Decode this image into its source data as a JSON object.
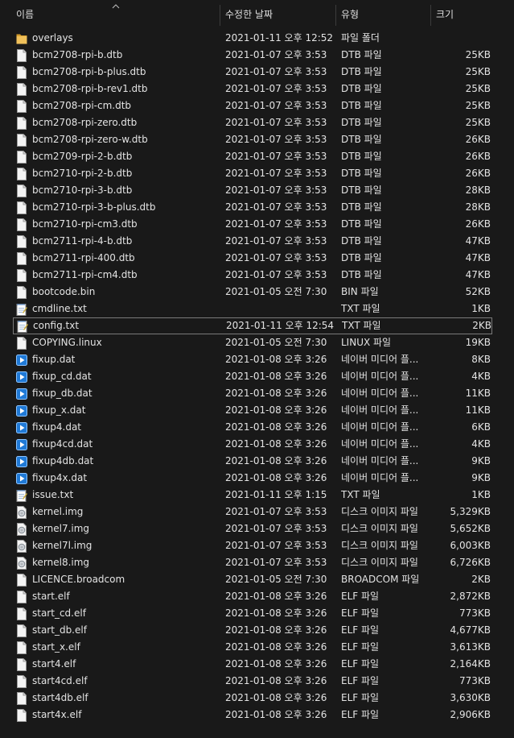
{
  "columns": {
    "name": "이름",
    "date": "수정한 날짜",
    "type": "유형",
    "size": "크기"
  },
  "colors": {
    "folder": "#e8b54a",
    "media": "#1f79d6",
    "selected_border": "#7a7a7a"
  },
  "files": [
    {
      "name": "overlays",
      "date": "2021-01-11 오후 12:52",
      "type": "파일 폴더",
      "size": "",
      "icon": "folder-icon"
    },
    {
      "name": "bcm2708-rpi-b.dtb",
      "date": "2021-01-07 오후 3:53",
      "type": "DTB 파일",
      "size": "25KB",
      "icon": "file-icon"
    },
    {
      "name": "bcm2708-rpi-b-plus.dtb",
      "date": "2021-01-07 오후 3:53",
      "type": "DTB 파일",
      "size": "25KB",
      "icon": "file-icon"
    },
    {
      "name": "bcm2708-rpi-b-rev1.dtb",
      "date": "2021-01-07 오후 3:53",
      "type": "DTB 파일",
      "size": "25KB",
      "icon": "file-icon"
    },
    {
      "name": "bcm2708-rpi-cm.dtb",
      "date": "2021-01-07 오후 3:53",
      "type": "DTB 파일",
      "size": "25KB",
      "icon": "file-icon"
    },
    {
      "name": "bcm2708-rpi-zero.dtb",
      "date": "2021-01-07 오후 3:53",
      "type": "DTB 파일",
      "size": "25KB",
      "icon": "file-icon"
    },
    {
      "name": "bcm2708-rpi-zero-w.dtb",
      "date": "2021-01-07 오후 3:53",
      "type": "DTB 파일",
      "size": "26KB",
      "icon": "file-icon"
    },
    {
      "name": "bcm2709-rpi-2-b.dtb",
      "date": "2021-01-07 오후 3:53",
      "type": "DTB 파일",
      "size": "26KB",
      "icon": "file-icon"
    },
    {
      "name": "bcm2710-rpi-2-b.dtb",
      "date": "2021-01-07 오후 3:53",
      "type": "DTB 파일",
      "size": "26KB",
      "icon": "file-icon"
    },
    {
      "name": "bcm2710-rpi-3-b.dtb",
      "date": "2021-01-07 오후 3:53",
      "type": "DTB 파일",
      "size": "28KB",
      "icon": "file-icon"
    },
    {
      "name": "bcm2710-rpi-3-b-plus.dtb",
      "date": "2021-01-07 오후 3:53",
      "type": "DTB 파일",
      "size": "28KB",
      "icon": "file-icon"
    },
    {
      "name": "bcm2710-rpi-cm3.dtb",
      "date": "2021-01-07 오후 3:53",
      "type": "DTB 파일",
      "size": "26KB",
      "icon": "file-icon"
    },
    {
      "name": "bcm2711-rpi-4-b.dtb",
      "date": "2021-01-07 오후 3:53",
      "type": "DTB 파일",
      "size": "47KB",
      "icon": "file-icon"
    },
    {
      "name": "bcm2711-rpi-400.dtb",
      "date": "2021-01-07 오후 3:53",
      "type": "DTB 파일",
      "size": "47KB",
      "icon": "file-icon"
    },
    {
      "name": "bcm2711-rpi-cm4.dtb",
      "date": "2021-01-07 오후 3:53",
      "type": "DTB 파일",
      "size": "47KB",
      "icon": "file-icon"
    },
    {
      "name": "bootcode.bin",
      "date": "2021-01-05 오전 7:30",
      "type": "BIN 파일",
      "size": "52KB",
      "icon": "file-icon"
    },
    {
      "name": "cmdline.txt",
      "date": "",
      "type": "TXT 파일",
      "size": "1KB",
      "icon": "notepad-icon"
    },
    {
      "name": "config.txt",
      "date": "2021-01-11 오후 12:54",
      "type": "TXT 파일",
      "size": "2KB",
      "icon": "notepad-icon",
      "selected": true
    },
    {
      "name": "COPYING.linux",
      "date": "2021-01-05 오전 7:30",
      "type": "LINUX 파일",
      "size": "19KB",
      "icon": "file-icon"
    },
    {
      "name": "fixup.dat",
      "date": "2021-01-08 오후 3:26",
      "type": "네이버 미디어 플...",
      "size": "8KB",
      "icon": "media-play-icon"
    },
    {
      "name": "fixup_cd.dat",
      "date": "2021-01-08 오후 3:26",
      "type": "네이버 미디어 플...",
      "size": "4KB",
      "icon": "media-play-icon"
    },
    {
      "name": "fixup_db.dat",
      "date": "2021-01-08 오후 3:26",
      "type": "네이버 미디어 플...",
      "size": "11KB",
      "icon": "media-play-icon"
    },
    {
      "name": "fixup_x.dat",
      "date": "2021-01-08 오후 3:26",
      "type": "네이버 미디어 플...",
      "size": "11KB",
      "icon": "media-play-icon"
    },
    {
      "name": "fixup4.dat",
      "date": "2021-01-08 오후 3:26",
      "type": "네이버 미디어 플...",
      "size": "6KB",
      "icon": "media-play-icon"
    },
    {
      "name": "fixup4cd.dat",
      "date": "2021-01-08 오후 3:26",
      "type": "네이버 미디어 플...",
      "size": "4KB",
      "icon": "media-play-icon"
    },
    {
      "name": "fixup4db.dat",
      "date": "2021-01-08 오후 3:26",
      "type": "네이버 미디어 플...",
      "size": "9KB",
      "icon": "media-play-icon"
    },
    {
      "name": "fixup4x.dat",
      "date": "2021-01-08 오후 3:26",
      "type": "네이버 미디어 플...",
      "size": "9KB",
      "icon": "media-play-icon"
    },
    {
      "name": "issue.txt",
      "date": "2021-01-11 오후 1:15",
      "type": "TXT 파일",
      "size": "1KB",
      "icon": "notepad-icon"
    },
    {
      "name": "kernel.img",
      "date": "2021-01-07 오후 3:53",
      "type": "디스크 이미지 파일",
      "size": "5,329KB",
      "icon": "disc-image-icon"
    },
    {
      "name": "kernel7.img",
      "date": "2021-01-07 오후 3:53",
      "type": "디스크 이미지 파일",
      "size": "5,652KB",
      "icon": "disc-image-icon"
    },
    {
      "name": "kernel7l.img",
      "date": "2021-01-07 오후 3:53",
      "type": "디스크 이미지 파일",
      "size": "6,003KB",
      "icon": "disc-image-icon"
    },
    {
      "name": "kernel8.img",
      "date": "2021-01-07 오후 3:53",
      "type": "디스크 이미지 파일",
      "size": "6,726KB",
      "icon": "disc-image-icon"
    },
    {
      "name": "LICENCE.broadcom",
      "date": "2021-01-05 오전 7:30",
      "type": "BROADCOM 파일",
      "size": "2KB",
      "icon": "file-icon"
    },
    {
      "name": "start.elf",
      "date": "2021-01-08 오후 3:26",
      "type": "ELF 파일",
      "size": "2,872KB",
      "icon": "file-icon"
    },
    {
      "name": "start_cd.elf",
      "date": "2021-01-08 오후 3:26",
      "type": "ELF 파일",
      "size": "773KB",
      "icon": "file-icon"
    },
    {
      "name": "start_db.elf",
      "date": "2021-01-08 오후 3:26",
      "type": "ELF 파일",
      "size": "4,677KB",
      "icon": "file-icon"
    },
    {
      "name": "start_x.elf",
      "date": "2021-01-08 오후 3:26",
      "type": "ELF 파일",
      "size": "3,613KB",
      "icon": "file-icon"
    },
    {
      "name": "start4.elf",
      "date": "2021-01-08 오후 3:26",
      "type": "ELF 파일",
      "size": "2,164KB",
      "icon": "file-icon"
    },
    {
      "name": "start4cd.elf",
      "date": "2021-01-08 오후 3:26",
      "type": "ELF 파일",
      "size": "773KB",
      "icon": "file-icon"
    },
    {
      "name": "start4db.elf",
      "date": "2021-01-08 오후 3:26",
      "type": "ELF 파일",
      "size": "3,630KB",
      "icon": "file-icon"
    },
    {
      "name": "start4x.elf",
      "date": "2021-01-08 오후 3:26",
      "type": "ELF 파일",
      "size": "2,906KB",
      "icon": "file-icon"
    }
  ]
}
